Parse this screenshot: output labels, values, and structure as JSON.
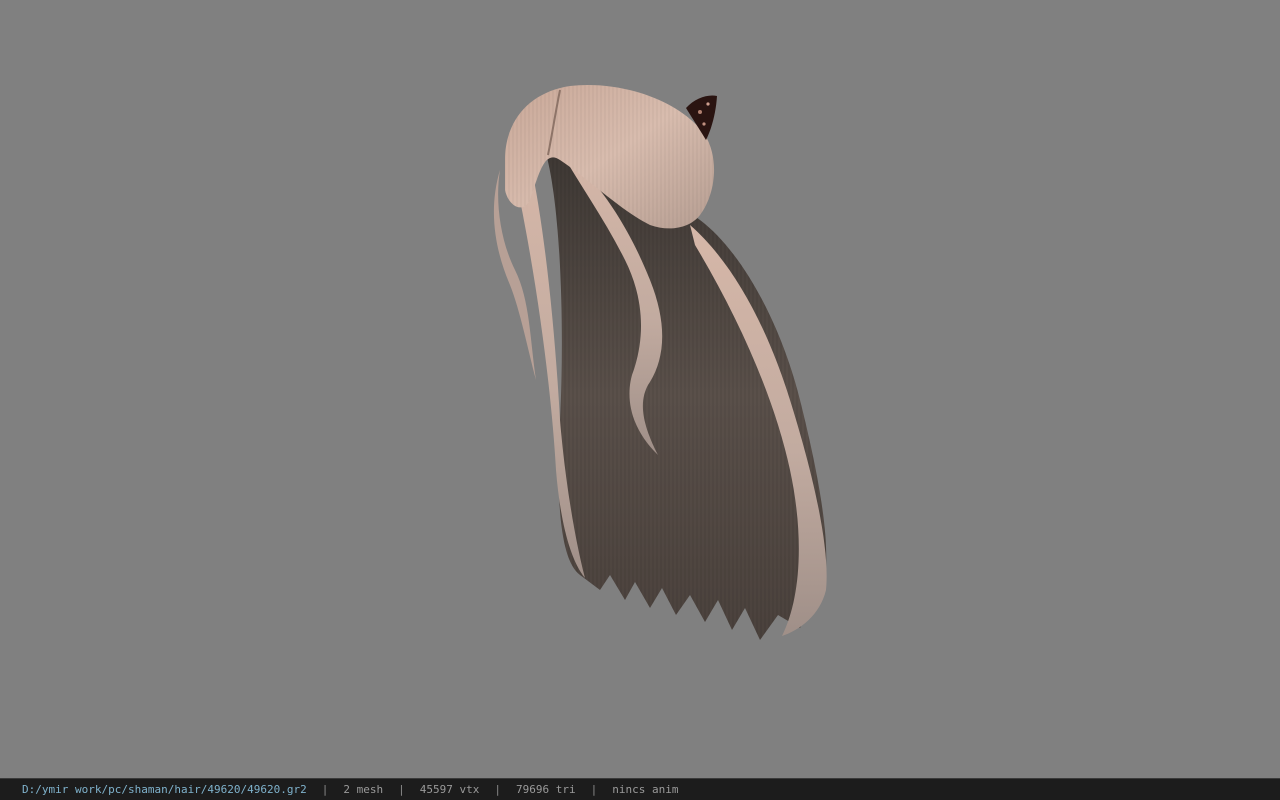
{
  "viewport": {
    "background_color": "#808080",
    "model": {
      "description_icon": "hair-model",
      "light_color": "#d2b3a4",
      "mid_color": "#a3918a",
      "shadow_color": "#4e4540",
      "accessory_color": "#2a1411"
    }
  },
  "statusbar": {
    "file_path": "D:/ymir work/pc/shaman/hair/49620/49620.gr2",
    "separator": "|",
    "mesh_count": "2 mesh",
    "vertex_count": "45597 vtx",
    "triangle_count": "79696 tri",
    "animation_status": "nincs anim"
  }
}
